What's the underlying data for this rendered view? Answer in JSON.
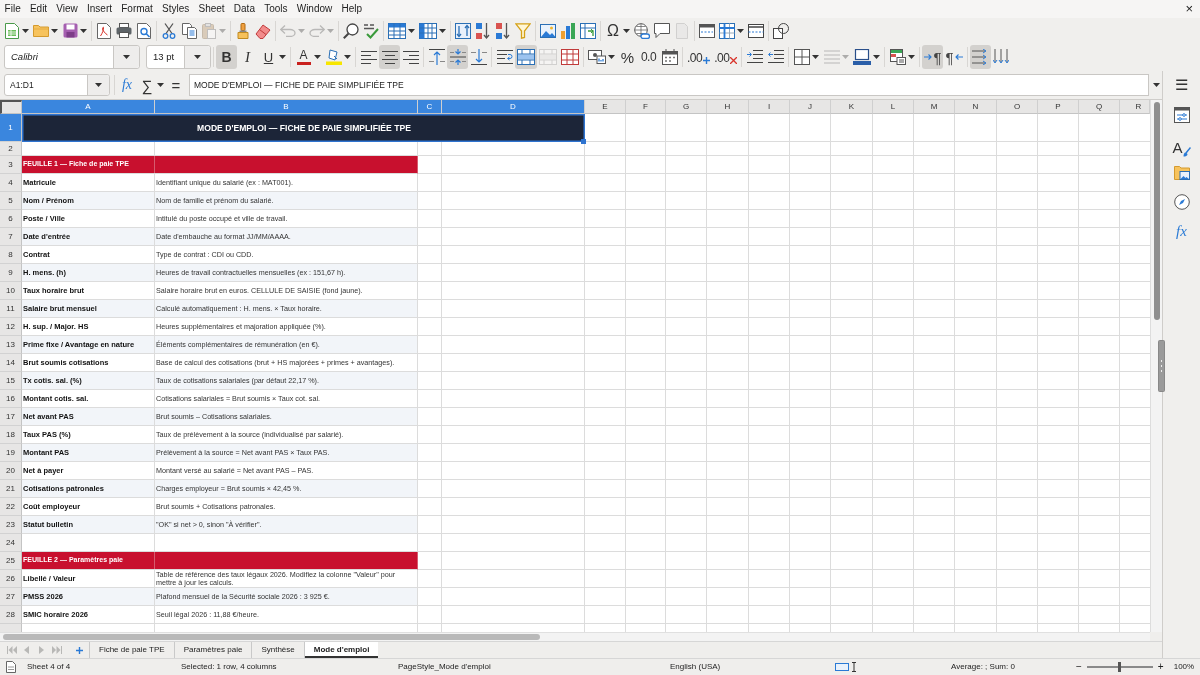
{
  "menu_bar": {
    "items": [
      "File",
      "Edit",
      "View",
      "Insert",
      "Format",
      "Styles",
      "Sheet",
      "Data",
      "Tools",
      "Window",
      "Help"
    ],
    "close": "×"
  },
  "standard_toolbar": {
    "paste": {
      "disabled": true
    },
    "undo": {
      "disabled": true
    },
    "redo": {
      "disabled": true
    },
    "special_character": {
      "glyph": "Ω"
    },
    "headers_footers": {
      "disabled": true
    }
  },
  "format_toolbar": {
    "font_name": "Calibri",
    "font_size": "13 pt",
    "bold": {
      "glyph": "B",
      "on": true
    },
    "italic": {
      "glyph": "I",
      "on": false
    },
    "underline": {
      "glyph": "U",
      "on": false
    },
    "font_color": {
      "glyph": "A"
    },
    "align_left": {
      "on": false
    },
    "align_center": {
      "on": true
    },
    "align_right": {
      "on": false
    },
    "align_top": {
      "on": false
    },
    "align_middle": {
      "on": true
    },
    "align_bottom": {
      "on": false
    },
    "wrap_text": {
      "on": false
    },
    "merge_center": {
      "on": true
    },
    "merge_cells": {
      "disabled": true
    },
    "percent": {
      "glyph": "%"
    },
    "number": {
      "glyph": "0.0"
    },
    "add_decimal": {
      "glyph": ".00"
    },
    "delete_decimal": {
      "glyph": ".00"
    },
    "border_style": {
      "disabled": true
    },
    "left_to_right": {
      "glyph": "¶",
      "on": true
    },
    "right_to_left": {
      "glyph": "¶",
      "on": false
    },
    "text_horizontal": {
      "on": true
    },
    "text_vertical": {
      "on": false
    }
  },
  "formula_bar": {
    "name_box": "A1:D1",
    "function_wizard": "fx",
    "sum": "∑",
    "equals": "=",
    "formula": "MODE D'EMPLOI — FICHE DE PAIE SIMPLIFIÉE TPE"
  },
  "sidebar": {
    "menu": "☰",
    "tabs": [
      {
        "selected": false
      },
      {
        "glyph": "A",
        "selected": false
      },
      {
        "selected": false
      },
      {
        "selected": false
      },
      {
        "glyph": "fx",
        "selected": false
      }
    ]
  },
  "sheet": {
    "columns": [
      {
        "label": "A",
        "selected": true
      },
      {
        "label": "B",
        "selected": true
      },
      {
        "label": "C",
        "selected": true
      },
      {
        "label": "D",
        "selected": true
      },
      {
        "label": "E",
        "selected": false
      },
      {
        "label": "F",
        "selected": false
      },
      {
        "label": "G",
        "selected": false
      },
      {
        "label": "H",
        "selected": false
      },
      {
        "label": "I",
        "selected": false
      },
      {
        "label": "J",
        "selected": false
      },
      {
        "label": "K",
        "selected": false
      },
      {
        "label": "L",
        "selected": false
      },
      {
        "label": "M",
        "selected": false
      },
      {
        "label": "N",
        "selected": false
      },
      {
        "label": "O",
        "selected": false
      },
      {
        "label": "P",
        "selected": false
      },
      {
        "label": "Q",
        "selected": false
      },
      {
        "label": "R",
        "selected": false
      }
    ],
    "rows": [
      {
        "number": "1",
        "selected": true,
        "kind": "title",
        "cells": [
          "MODE D'EMPLOI — FICHE DE PAIE SIMPLIFIÉE TPE"
        ]
      },
      {
        "number": "2",
        "selected": false,
        "kind": "blank"
      },
      {
        "number": "3",
        "selected": false,
        "kind": "section",
        "cells": [
          "FEUILLE 1 — Fiche de paie TPE"
        ]
      },
      {
        "number": "4",
        "selected": false,
        "kind": "entry",
        "shaded": false,
        "cells": [
          "Matricule",
          "Identifiant unique du salarié (ex : MAT001)."
        ]
      },
      {
        "number": "5",
        "selected": false,
        "kind": "entry",
        "shaded": true,
        "cells": [
          "Nom / Prénom",
          "Nom de famille et prénom du salarié."
        ]
      },
      {
        "number": "6",
        "selected": false,
        "kind": "entry",
        "shaded": false,
        "cells": [
          "Poste / Ville",
          "Intitulé du poste occupé et ville de travail."
        ]
      },
      {
        "number": "7",
        "selected": false,
        "kind": "entry",
        "shaded": true,
        "cells": [
          "Date d'entrée",
          "Date d'embauche au format JJ/MM/AAAA."
        ]
      },
      {
        "number": "8",
        "selected": false,
        "kind": "entry",
        "shaded": false,
        "cells": [
          "Contrat",
          "Type de contrat : CDI ou CDD."
        ]
      },
      {
        "number": "9",
        "selected": false,
        "kind": "entry",
        "shaded": true,
        "cells": [
          "H. mens. (h)",
          "Heures de travail contractuelles mensuelles (ex : 151,67 h)."
        ]
      },
      {
        "number": "10",
        "selected": false,
        "kind": "entry",
        "shaded": false,
        "cells": [
          "Taux horaire brut",
          "Salaire horaire brut en euros. CELLULE DE SAISIE (fond jaune)."
        ]
      },
      {
        "number": "11",
        "selected": false,
        "kind": "entry",
        "shaded": true,
        "cells": [
          "Salaire brut mensuel",
          "Calculé automatiquement : H. mens. × Taux horaire."
        ]
      },
      {
        "number": "12",
        "selected": false,
        "kind": "entry",
        "shaded": false,
        "cells": [
          "H. sup. / Major. HS",
          "Heures supplémentaires et majoration appliquée (%)."
        ]
      },
      {
        "number": "13",
        "selected": false,
        "kind": "entry",
        "shaded": true,
        "cells": [
          "Prime fixe / Avantage en nature",
          "Éléments complémentaires de rémunération (en €)."
        ]
      },
      {
        "number": "14",
        "selected": false,
        "kind": "entry",
        "shaded": false,
        "cells": [
          "Brut soumis cotisations",
          "Base de calcul des cotisations (brut + HS majorées + primes + avantages)."
        ]
      },
      {
        "number": "15",
        "selected": false,
        "kind": "entry",
        "shaded": true,
        "cells": [
          "Tx cotis. sal. (%)",
          "Taux de cotisations salariales (par défaut 22,17 %)."
        ]
      },
      {
        "number": "16",
        "selected": false,
        "kind": "entry",
        "shaded": false,
        "cells": [
          "Montant cotis. sal.",
          "Cotisations salariales = Brut soumis × Taux cot. sal."
        ]
      },
      {
        "number": "17",
        "selected": false,
        "kind": "entry",
        "shaded": true,
        "cells": [
          "Net avant PAS",
          "Brut soumis – Cotisations salariales."
        ]
      },
      {
        "number": "18",
        "selected": false,
        "kind": "entry",
        "shaded": false,
        "cells": [
          "Taux PAS (%)",
          "Taux de prélèvement à la source (individualisé par salarié)."
        ]
      },
      {
        "number": "19",
        "selected": false,
        "kind": "entry",
        "shaded": true,
        "cells": [
          "Montant PAS",
          "Prélèvement à la source = Net avant PAS × Taux PAS."
        ]
      },
      {
        "number": "20",
        "selected": false,
        "kind": "entry",
        "shaded": false,
        "cells": [
          "Net à payer",
          "Montant versé au salarié = Net avant PAS – PAS."
        ]
      },
      {
        "number": "21",
        "selected": false,
        "kind": "entry",
        "shaded": true,
        "cells": [
          "Cotisations patronales",
          "Charges employeur = Brut soumis × 42,45 %."
        ]
      },
      {
        "number": "22",
        "selected": false,
        "kind": "entry",
        "shaded": false,
        "cells": [
          "Coût employeur",
          "Brut soumis + Cotisations patronales."
        ]
      },
      {
        "number": "23",
        "selected": false,
        "kind": "entry",
        "shaded": true,
        "cells": [
          "Statut bulletin",
          "\"OK\" si net > 0, sinon \"À vérifier\"."
        ]
      },
      {
        "number": "24",
        "selected": false,
        "kind": "blank"
      },
      {
        "number": "25",
        "selected": false,
        "kind": "section",
        "cells": [
          "FEUILLE 2 — Paramètres paie"
        ]
      },
      {
        "number": "26",
        "selected": false,
        "kind": "entry",
        "shaded": false,
        "cells": [
          "Libellé / Valeur",
          "Table de référence des taux légaux 2026. Modifiez la colonne \"Valeur\" pour mettre à jour les calculs."
        ]
      },
      {
        "number": "27",
        "selected": false,
        "kind": "entry",
        "shaded": true,
        "cells": [
          "PMSS 2026",
          "Plafond mensuel de la Sécurité sociale 2026 : 3 925 €."
        ]
      },
      {
        "number": "28",
        "selected": false,
        "kind": "entry",
        "shaded": false,
        "cells": [
          "SMIC horaire 2026",
          "Seuil légal 2026 : 11,88 €/heure."
        ]
      },
      {
        "selected": false,
        "kind": "blank"
      }
    ]
  },
  "sheet_navigation": [
    {
      "disabled": true
    },
    {
      "disabled": true
    },
    {
      "disabled": true
    },
    {
      "disabled": true
    }
  ],
  "sheet_tabs": [
    {
      "label": "Fiche de paie TPE",
      "selected": false
    },
    {
      "label": "Paramètres paie",
      "selected": false
    },
    {
      "label": "Synthèse",
      "selected": false
    },
    {
      "label": "Mode d'emploi",
      "selected": true
    }
  ],
  "status_bar": {
    "sheet": "Sheet 4 of 4",
    "selection": "Selected: 1 row, 4 columns",
    "page_style": "PageStyle_Mode d'emploi",
    "language": "English (USA)",
    "sum": "Average: ; Sum: 0",
    "zoom": {
      "out": "−",
      "in": "+",
      "level": 0.5,
      "percent": "100%"
    }
  }
}
